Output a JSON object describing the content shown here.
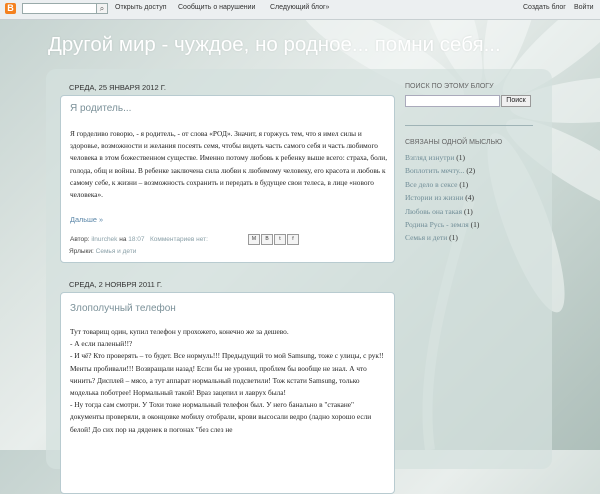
{
  "navbar": {
    "logo_letter": "B",
    "search_placeholder": "",
    "links": [
      "Открыть доступ",
      "Сообщить о нарушении",
      "Следующий блог»"
    ],
    "right_links": [
      "Создать блог",
      "Войти"
    ]
  },
  "blog": {
    "title": "Другой мир - чуждое, но родное... помни себя..."
  },
  "posts": [
    {
      "date": "СРЕДА, 25 ЯНВАРЯ 2012 Г.",
      "title": "Я родитель...",
      "body": "Я горделиво говорю, - я родитель, - от слова «РОД». Значит, я горжусь тем, что я имел силы и здоровье, возможности и желания посеять семя, чтобы видеть часть самого себя и часть любимого человека в этом божественном существе. Именно потому любовь к ребенку выше всего: страха, боли, голода, общ и войны. В ребенке заключена сила любви к любимому человеку, его красота и любовь к самому себе, к жизни – возможность сохранить и передать в будущее свои телеса, в лице «нового человека».",
      "read_more": "Дальше »",
      "author_label": "Автор:",
      "author": "ilnurchek",
      "time_prefix": "на",
      "time": "18:07",
      "comments": "Комментариев нет:",
      "share_icons": [
        "M",
        "B",
        "t",
        "f"
      ],
      "labels_label": "Ярлыки:",
      "labels": "Семья и дети"
    },
    {
      "date": "СРЕДА, 2 НОЯБРЯ 2011 Г.",
      "title": "Злополучный телефон",
      "lines": [
        "Тут товарищ один, купил телефон у прохожего, конечно же за дешево.",
        "- А если паленый!!?",
        "- И чё? Кто проверять – то будет. Все нормуль!!! Предыдущий то мой Samsung, тоже с улицы, с рук!! Менты пробивали!!! Возвращали назад! Если бы не уронил, проблем бы вообще не знал. А что чинить? Дисплей – мясо, а тут аппарат нормальный подсветили! Тож кстати Samsung, только моделька поботрее! Нормальный такой! Враз зацепил и лаврух была!",
        "- Ну тогда сам смотри. У Тохи тоже нормальный телефон был. У него банально в \"стакане\" документы проверяли, в оконцовке мобилу отобрали, крови высосали ведро (ладно хорошо если белой! До сих пор на дяденек в погонах \"без слез не"
      ]
    }
  ],
  "sidebar": {
    "search_title": "ПОИСК ПО ЭТОМУ БЛОГУ",
    "search_button": "Поиск",
    "related_title": "СВЯЗАНЫ ОДНОЙ МЫСЛЬЮ",
    "items": [
      {
        "label": "Взгляд изнутри",
        "count": "(1)"
      },
      {
        "label": "Воплотить мечту...",
        "count": "(2)"
      },
      {
        "label": "Все дело в сексе",
        "count": "(1)"
      },
      {
        "label": "Истории из жизни",
        "count": "(4)"
      },
      {
        "label": "Любовь она такая",
        "count": "(1)"
      },
      {
        "label": "Родина Русь - земля",
        "count": "(1)"
      },
      {
        "label": "Семья и дети",
        "count": "(1)"
      }
    ]
  }
}
